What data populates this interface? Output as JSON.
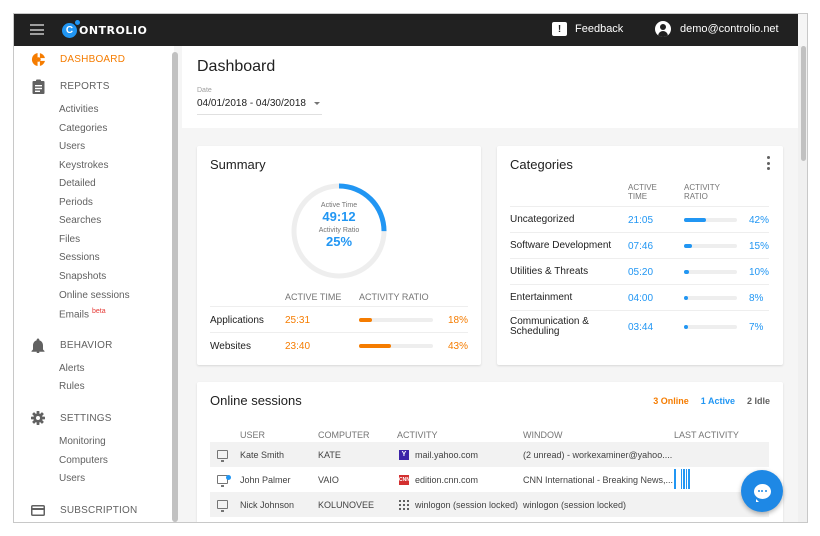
{
  "header": {
    "brand": "ONTROLIO",
    "brand_letter": "C",
    "feedback_label": "Feedback",
    "feedback_icon_glyph": "!",
    "user_email": "demo@controlio.net"
  },
  "sidebar": {
    "dashboard": "DASHBOARD",
    "reports": {
      "label": "REPORTS",
      "items": [
        "Activities",
        "Categories",
        "Users",
        "Keystrokes",
        "Detailed",
        "Periods",
        "Searches",
        "Files",
        "Sessions",
        "Snapshots",
        "Online sessions",
        "Emails"
      ],
      "emails_badge": "beta"
    },
    "behavior": {
      "label": "BEHAVIOR",
      "items": [
        "Alerts",
        "Rules"
      ]
    },
    "settings": {
      "label": "SETTINGS",
      "items": [
        "Monitoring",
        "Computers",
        "Users"
      ]
    },
    "subscription": "SUBSCRIPTION"
  },
  "page": {
    "title": "Dashboard",
    "date_label": "Date",
    "date_value": "04/01/2018 - 04/30/2018"
  },
  "summary": {
    "title": "Summary",
    "active_time_label": "Active Time",
    "active_time": "49:12",
    "activity_ratio_label": "Activity Ratio",
    "activity_ratio": "25%",
    "activity_ratio_fraction": 0.25,
    "col_active_time": "ACTIVE TIME",
    "col_activity_ratio": "ACTIVITY RATIO",
    "rows": [
      {
        "name": "Applications",
        "time": "25:31",
        "ratio": 0.18,
        "pct": "18%"
      },
      {
        "name": "Websites",
        "time": "23:40",
        "ratio": 0.43,
        "pct": "43%"
      }
    ]
  },
  "categories": {
    "title": "Categories",
    "col_active_time": [
      "ACTIVE",
      "TIME"
    ],
    "col_activity_ratio": [
      "ACTIVITY",
      "RATIO"
    ],
    "rows": [
      {
        "name": "Uncategorized",
        "time": "21:05",
        "ratio": 0.42,
        "pct": "42%"
      },
      {
        "name": "Software Development",
        "time": "07:46",
        "ratio": 0.15,
        "pct": "15%"
      },
      {
        "name": "Utilities & Threats",
        "time": "05:20",
        "ratio": 0.1,
        "pct": "10%"
      },
      {
        "name": "Entertainment",
        "time": "04:00",
        "ratio": 0.08,
        "pct": "8%"
      },
      {
        "name": "Communication & Scheduling",
        "name_line1": "Communication &",
        "name_line2": "Scheduling",
        "time": "03:44",
        "ratio": 0.07,
        "pct": "7%"
      }
    ]
  },
  "online_sessions": {
    "title": "Online sessions",
    "online": "3 Online",
    "active": "1 Active",
    "idle": "2 Idle",
    "columns": [
      "USER",
      "COMPUTER",
      "ACTIVITY",
      "WINDOW",
      "LAST ACTIVITY"
    ],
    "rows": [
      {
        "user": "Kate Smith",
        "computer": "KATE",
        "activity": "mail.yahoo.com",
        "activity_icon": "Y",
        "window": "(2 unread) - workexaminer@yahoo....",
        "active": false
      },
      {
        "user": "John Palmer",
        "computer": "VAIO",
        "activity": "edition.cnn.com",
        "activity_icon": "CNN",
        "window": "CNN International - Breaking News,...",
        "active": true
      },
      {
        "user": "Nick Johnson",
        "computer": "KOLUNOVEE",
        "activity": "winlogon (session locked)",
        "activity_icon": "",
        "window": "winlogon (session locked)",
        "active": false
      }
    ]
  },
  "colors": {
    "accent_orange": "#f57c00",
    "accent_blue": "#2196f3",
    "topbar": "#212121"
  }
}
